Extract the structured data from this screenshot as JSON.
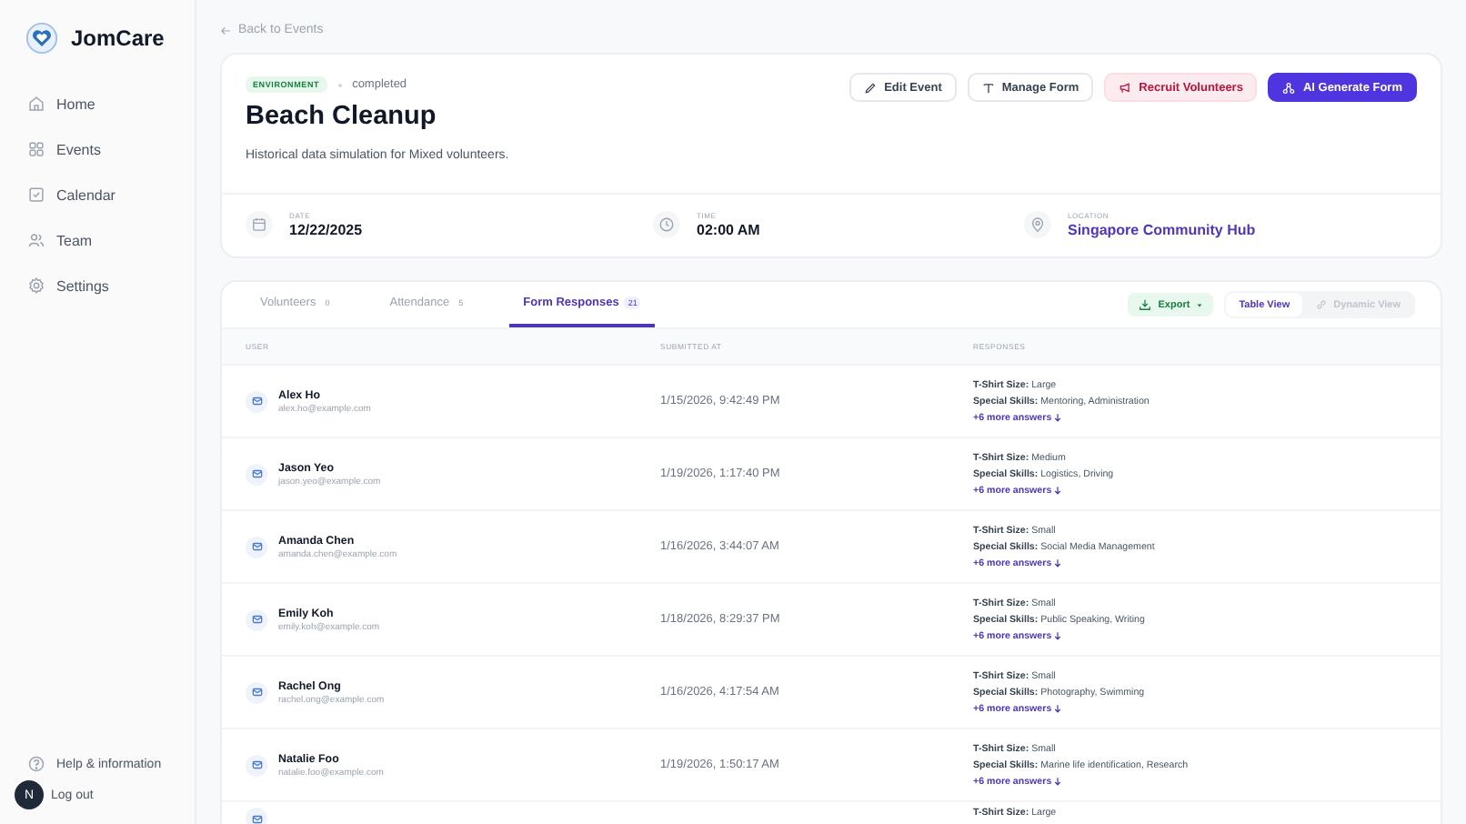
{
  "sidebar": {
    "brand": "JomCare",
    "items": [
      {
        "label": "Home"
      },
      {
        "label": "Events"
      },
      {
        "label": "Calendar"
      },
      {
        "label": "Team"
      },
      {
        "label": "Settings"
      }
    ],
    "help": "Help & information",
    "avatar": "N",
    "logout": "Log out"
  },
  "back_link": "Back to Events",
  "event": {
    "category": "ENVIRONMENT",
    "status": "completed",
    "title": "Beach Cleanup",
    "description": "Historical data simulation for Mixed volunteers.",
    "actions": [
      {
        "label": "Edit Event",
        "kind": "outline"
      },
      {
        "label": "Manage Form",
        "kind": "outline"
      },
      {
        "label": "Recruit Volunteers",
        "kind": "danger"
      },
      {
        "label": "AI Generate Form",
        "kind": "primary"
      }
    ],
    "details": [
      {
        "label": "DATE",
        "value": "12/22/2025",
        "kind": "plain"
      },
      {
        "label": "TIME",
        "value": "02:00 AM",
        "kind": "plain"
      },
      {
        "label": "LOCATION",
        "value": "Singapore Community Hub",
        "kind": "link"
      }
    ]
  },
  "tabs": [
    {
      "label": "Volunteers",
      "count": "0",
      "selected": false
    },
    {
      "label": "Attendance",
      "count": "5",
      "selected": false
    },
    {
      "label": "Form Responses",
      "count": "21",
      "selected": true
    }
  ],
  "export": "Export",
  "views": [
    {
      "label": "Table View",
      "selected": true
    },
    {
      "label": "Dynamic View",
      "selected": false
    }
  ],
  "table": {
    "columns": [
      "USER",
      "SUBMITTED AT",
      "RESPONSES"
    ],
    "rows": [
      {
        "name": "Alex Ho",
        "email": "alex.ho@example.com",
        "submitted": "1/15/2026, 9:42:49 PM",
        "answers": [
          "**T-Shirt Size:** Large",
          "**Special Skills:** Mentoring, Administration"
        ],
        "more": "+6 more answers"
      },
      {
        "name": "Jason Yeo",
        "email": "jason.yeo@example.com",
        "submitted": "1/19/2026, 1:17:40 PM",
        "answers": [
          "**T-Shirt Size:** Medium",
          "**Special Skills:** Logistics, Driving"
        ],
        "more": "+6 more answers"
      },
      {
        "name": "Amanda Chen",
        "email": "amanda.chen@example.com",
        "submitted": "1/16/2026, 3:44:07 AM",
        "answers": [
          "**T-Shirt Size:** Small",
          "**Special Skills:** Social Media Management"
        ],
        "more": "+6 more answers"
      },
      {
        "name": "Emily Koh",
        "email": "emily.koh@example.com",
        "submitted": "1/18/2026, 8:29:37 PM",
        "answers": [
          "**T-Shirt Size:** Small",
          "**Special Skills:** Public Speaking, Writing"
        ],
        "more": "+6 more answers"
      },
      {
        "name": "Rachel Ong",
        "email": "rachel.ong@example.com",
        "submitted": "1/16/2026, 4:17:54 AM",
        "answers": [
          "**T-Shirt Size:** Small",
          "**Special Skills:** Photography, Swimming"
        ],
        "more": "+6 more answers"
      },
      {
        "name": "Natalie Foo",
        "email": "natalie.foo@example.com",
        "submitted": "1/19/2026, 1:50:17 AM",
        "answers": [
          "**T-Shirt Size:** Small",
          "**Special Skills:** Marine life identification, Research"
        ],
        "more": "+6 more answers"
      },
      {
        "answers": [
          "**T-Shirt Size:** Large"
        ]
      }
    ]
  }
}
